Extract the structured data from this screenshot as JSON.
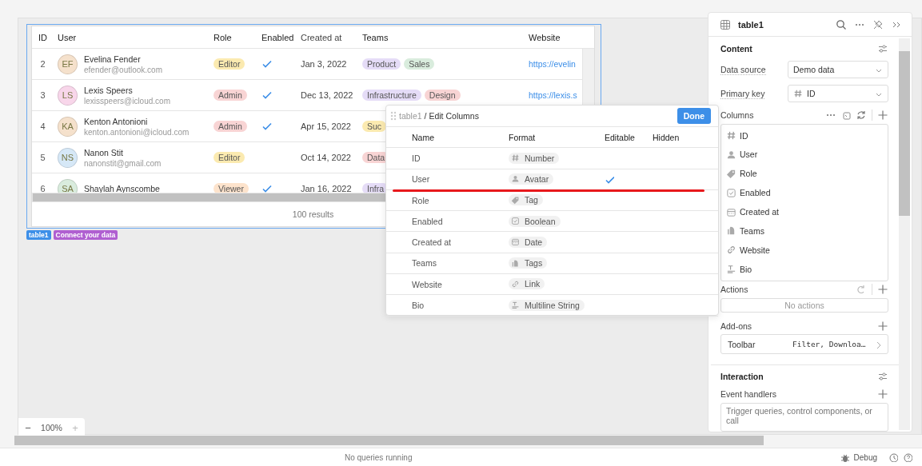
{
  "table": {
    "columns": [
      "ID",
      "User",
      "Role",
      "Enabled",
      "Created at",
      "Teams",
      "Website"
    ],
    "rows": [
      {
        "id": "2",
        "initials": "EF",
        "color": "#f5e1cc",
        "name": "Evelina Fender",
        "email": "efender@outlook.com",
        "role": {
          "label": "Editor",
          "color": "#fbeab0"
        },
        "enabled": true,
        "created": "Jan 3, 2022",
        "teams": [
          {
            "label": "Product",
            "color": "#e5dcf7"
          },
          {
            "label": "Sales",
            "color": "#d9ecdd"
          }
        ],
        "website": "https://evelin"
      },
      {
        "id": "3",
        "initials": "LS",
        "color": "#f8d6ea",
        "name": "Lexis Speers",
        "email": "lexisspeers@icloud.com",
        "role": {
          "label": "Admin",
          "color": "#f8d4d4"
        },
        "enabled": true,
        "created": "Dec 13, 2022",
        "teams": [
          {
            "label": "Infrastructure",
            "color": "#e5dcf7"
          },
          {
            "label": "Design",
            "color": "#f8d4d4"
          }
        ],
        "website": "https://lexis.s"
      },
      {
        "id": "4",
        "initials": "KA",
        "color": "#f5e1cc",
        "name": "Kenton Antonioni",
        "email": "kenton.antonioni@icloud.com",
        "role": {
          "label": "Admin",
          "color": "#f8d4d4"
        },
        "enabled": true,
        "created": "Apr 15, 2022",
        "teams": [
          {
            "label": "Suc",
            "color": "#fbeab0"
          }
        ]
      },
      {
        "id": "5",
        "initials": "NS",
        "color": "#d6e8f7",
        "name": "Nanon Stit",
        "email": "nanonstit@gmail.com",
        "role": {
          "label": "Editor",
          "color": "#fbeab0"
        },
        "enabled": false,
        "created": "Oct 14, 2022",
        "teams": [
          {
            "label": "Data",
            "color": "#f8d4d4"
          }
        ]
      },
      {
        "id": "6",
        "initials": "SA",
        "color": "#d9ecdd",
        "name": "Shaylah Aynscombe",
        "role": {
          "label": "Viewer",
          "color": "#fde3cc"
        },
        "enabled": true,
        "created": "Jan 16, 2022",
        "teams": [
          {
            "label": "Infra",
            "color": "#e5dcf7"
          }
        ]
      }
    ],
    "footer": "100 results"
  },
  "component_tags": [
    {
      "label": "table1",
      "kind": "name"
    },
    {
      "label": "Connect your data",
      "kind": "connect"
    }
  ],
  "editor": {
    "breadcrumb": "table1",
    "title": "/ Edit Columns",
    "done": "Done",
    "columns": [
      "Name",
      "Format",
      "Editable",
      "Hidden"
    ],
    "rows": [
      {
        "name": "ID",
        "format": "Number",
        "kind": "number",
        "editable": false,
        "hidden": false
      },
      {
        "name": "User",
        "format": "Avatar",
        "kind": "avatar",
        "editable": true,
        "hidden": false
      },
      {
        "name": "Role",
        "format": "Tag",
        "kind": "tag",
        "editable": false,
        "hidden": false
      },
      {
        "name": "Enabled",
        "format": "Boolean",
        "kind": "boolean",
        "editable": false,
        "hidden": false
      },
      {
        "name": "Created at",
        "format": "Date",
        "kind": "date",
        "editable": false,
        "hidden": false
      },
      {
        "name": "Teams",
        "format": "Tags",
        "kind": "tags",
        "editable": false,
        "hidden": false
      },
      {
        "name": "Website",
        "format": "Link",
        "kind": "link",
        "editable": false,
        "hidden": false
      },
      {
        "name": "Bio",
        "format": "Multiline String",
        "kind": "multiline",
        "editable": false,
        "hidden": false
      }
    ]
  },
  "zoom": {
    "minus": "−",
    "value": "100%",
    "plus": "+"
  },
  "inspector": {
    "title": "table1",
    "content": {
      "heading": "Content",
      "data_source": {
        "label": "Data source",
        "value": "Demo data"
      },
      "primary_key": {
        "label": "Primary key",
        "value": "ID"
      },
      "columns_label": "Columns",
      "columns": [
        {
          "name": "ID",
          "kind": "number"
        },
        {
          "name": "User",
          "kind": "avatar"
        },
        {
          "name": "Role",
          "kind": "tag"
        },
        {
          "name": "Enabled",
          "kind": "boolean"
        },
        {
          "name": "Created at",
          "kind": "date"
        },
        {
          "name": "Teams",
          "kind": "tags"
        },
        {
          "name": "Website",
          "kind": "link"
        },
        {
          "name": "Bio",
          "kind": "multiline"
        }
      ],
      "actions_label": "Actions",
      "actions_empty": "No actions",
      "addons_label": "Add-ons",
      "addon": {
        "name": "Toolbar",
        "value": "Filter, Downloa…"
      }
    },
    "interaction": {
      "heading": "Interaction",
      "event_handlers": "Event handlers",
      "placeholder": "Trigger queries, control components, or call"
    }
  },
  "status_bar": {
    "message": "No queries running",
    "debug": "Debug"
  }
}
